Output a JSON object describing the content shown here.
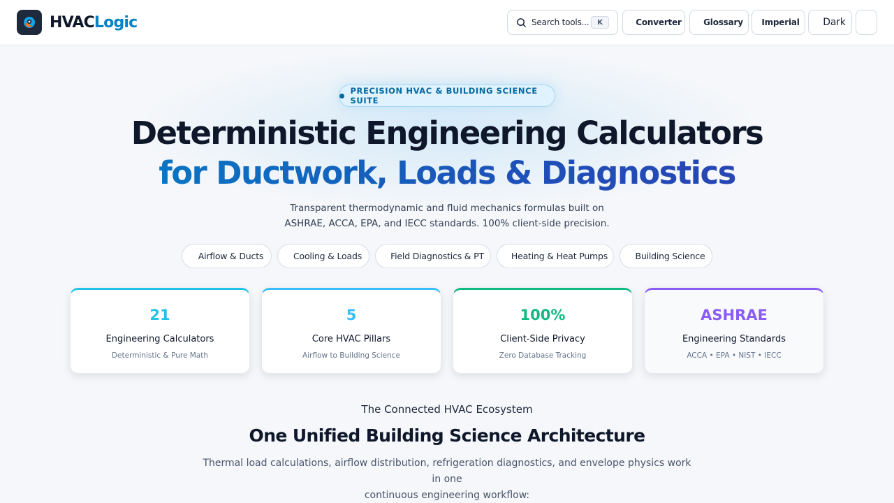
{
  "header": {
    "logo_part1": "HVAC",
    "logo_part2": "Logic",
    "search_placeholder": "Search tools...",
    "search_shortcut": "K",
    "converter_label": "Converter",
    "glossary_label": "Glossary",
    "units_label": "Imperial",
    "theme_label": "Dark"
  },
  "hero": {
    "badge": "PRECISION HVAC & BUILDING SCIENCE SUITE",
    "title_line1": "Deterministic Engineering Calculators",
    "title_line2": "for Ductwork, Loads & Diagnostics",
    "subtitle_line1": "Transparent thermodynamic and fluid mechanics formulas built on",
    "subtitle_line2": "ASHRAE, ACCA, EPA, and IECC standards. 100% client-side precision.",
    "categories": [
      "Airflow & Ducts",
      "Cooling & Loads",
      "Field Diagnostics & PT",
      "Heating & Heat Pumps",
      "Building Science"
    ]
  },
  "stats": [
    {
      "value": "21",
      "title": "Engineering Calculators",
      "sub": "Deterministic & Pure Math",
      "color": "#22c1e6"
    },
    {
      "value": "5",
      "title": "Core HVAC Pillars",
      "sub": "Airflow to Building Science",
      "color": "#38bdf8"
    },
    {
      "value": "100%",
      "title": "Client-Side Privacy",
      "sub": "Zero Database Tracking",
      "color": "#10b981"
    },
    {
      "value": "ASHRAE",
      "title": "Engineering Standards",
      "sub": "ACCA • EPA • NIST • IECC",
      "color": "#8b5cf6"
    }
  ],
  "ecosystem": {
    "kicker": "The Connected HVAC Ecosystem",
    "title": "One Unified Building Science Architecture",
    "desc_line1": "Thermal load calculations, airflow distribution, refrigeration diagnostics, and envelope physics work in one",
    "desc_line2": "continuous engineering workflow:"
  }
}
